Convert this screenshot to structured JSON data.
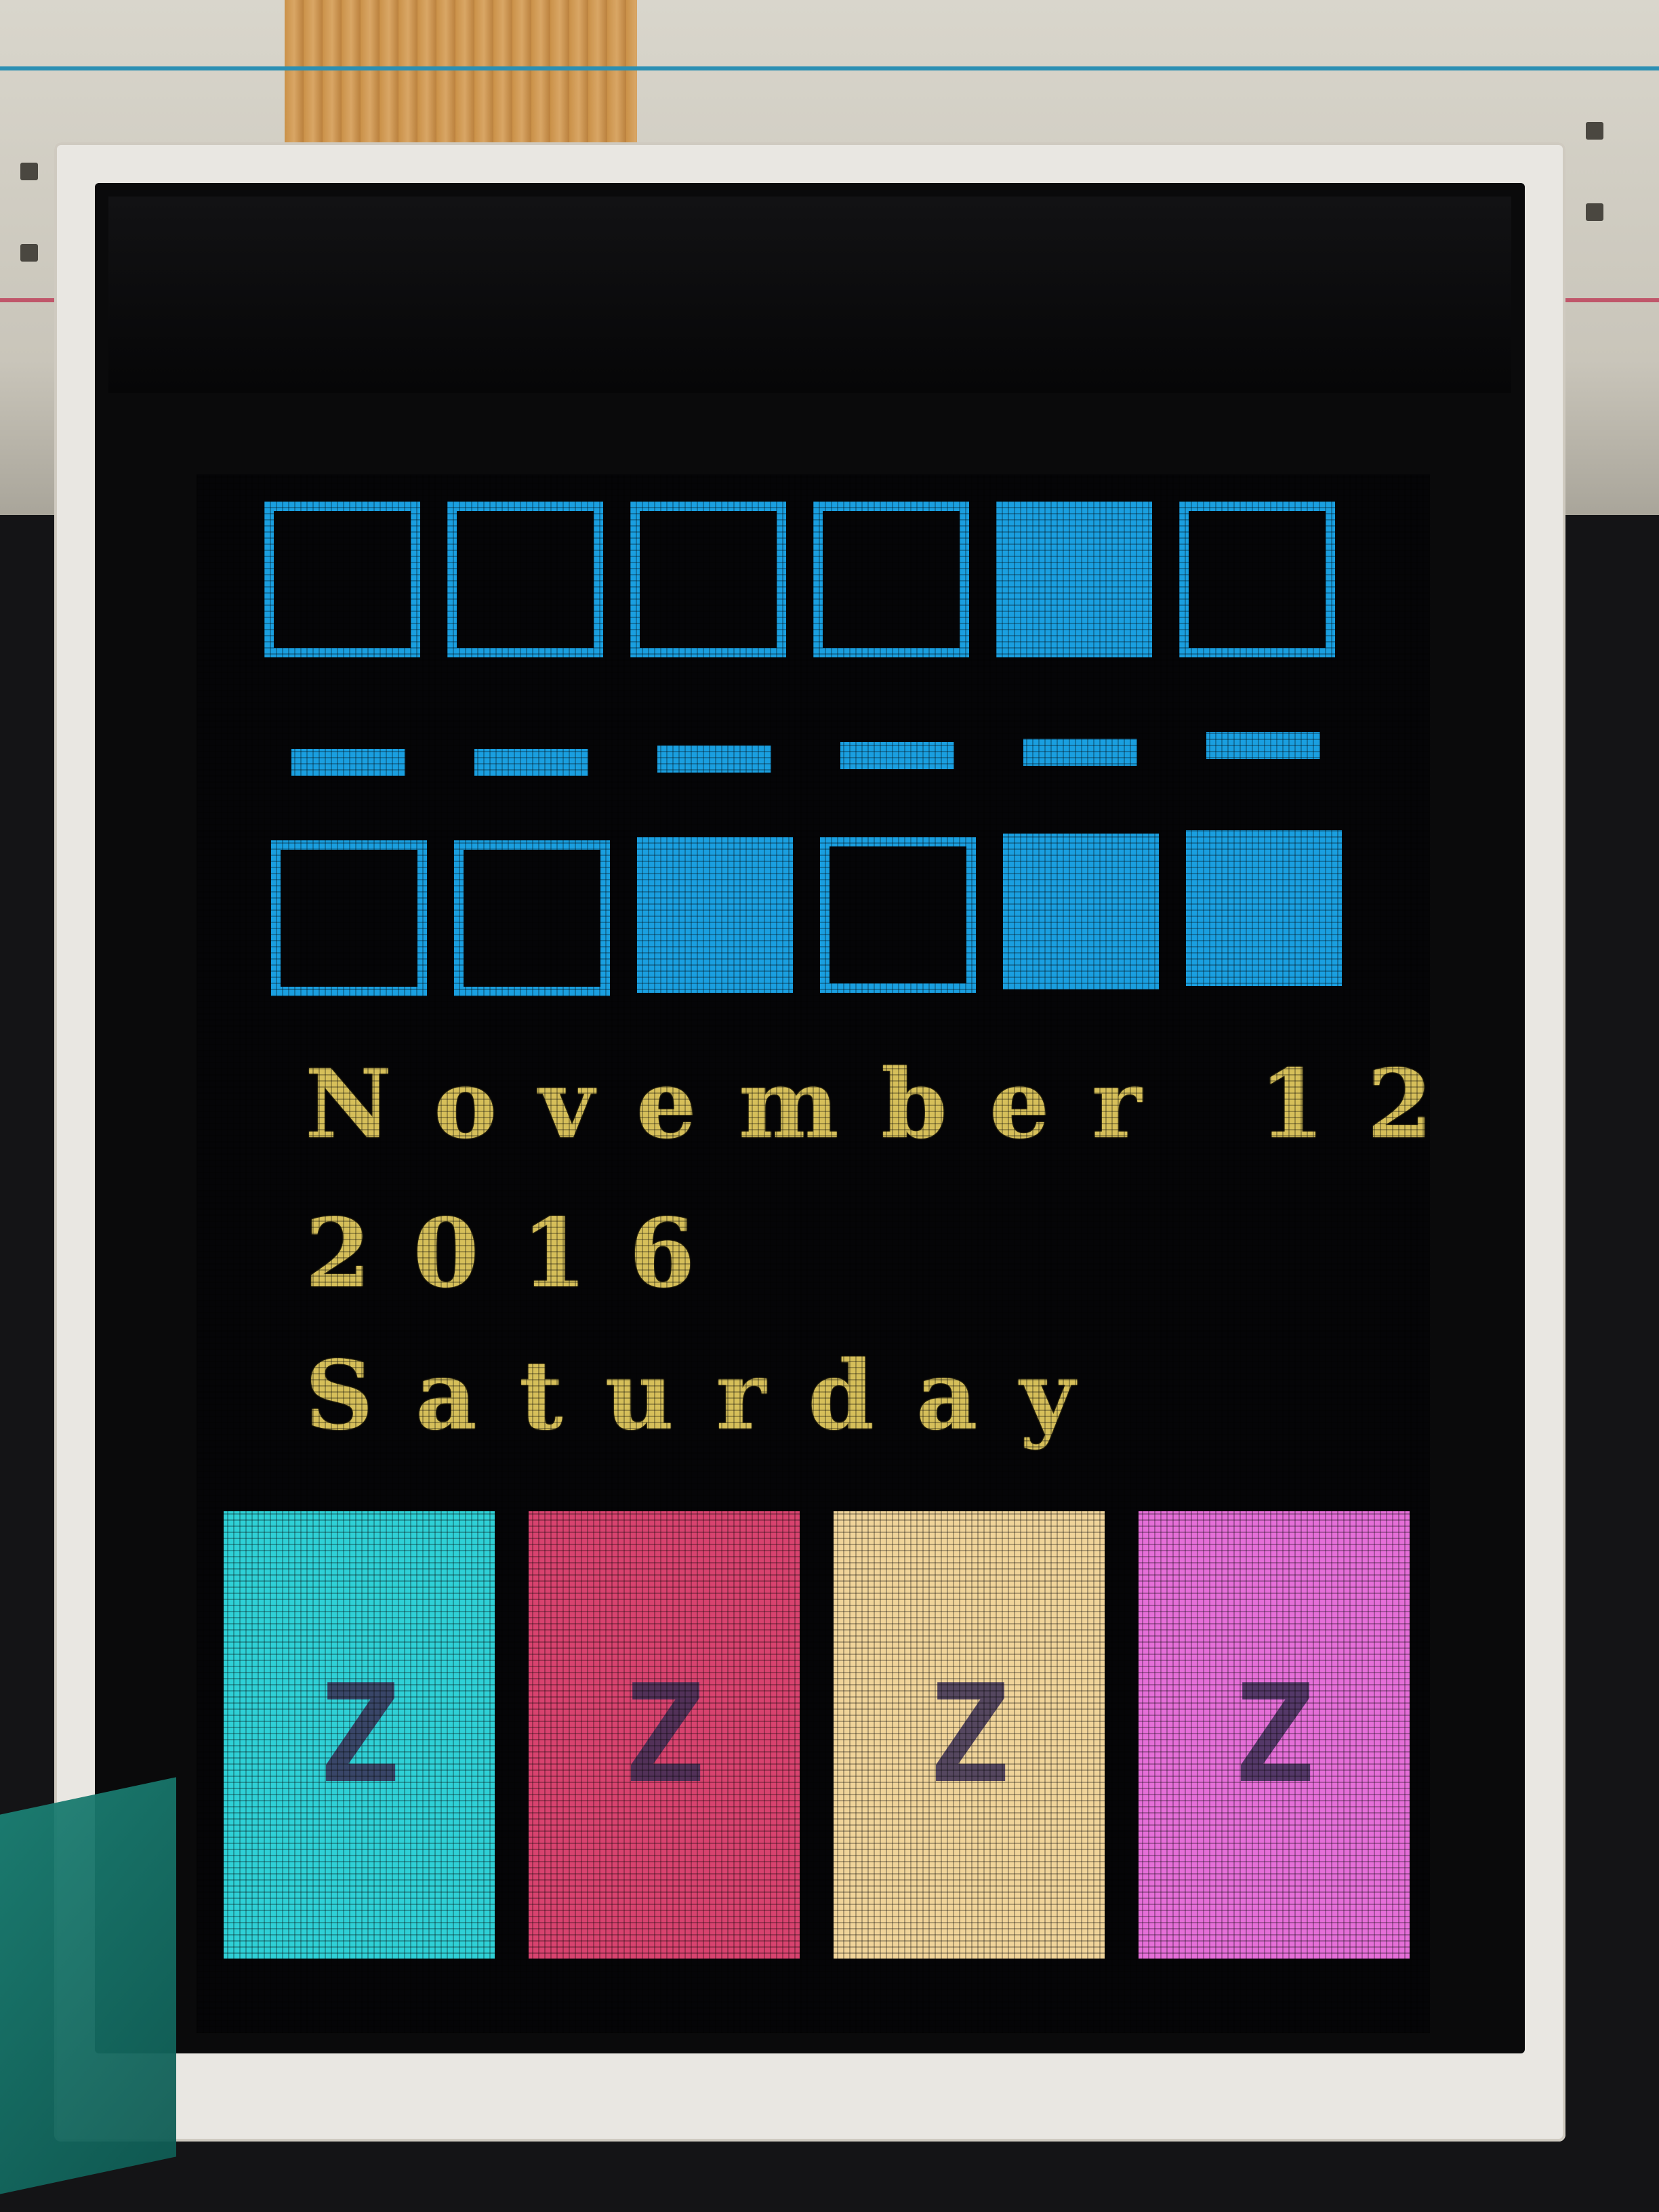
{
  "display": {
    "top_row_bits": [
      false,
      false,
      false,
      false,
      true,
      false
    ],
    "bottom_row_bits": [
      false,
      false,
      true,
      false,
      true,
      true
    ],
    "date_line": "November 12",
    "year_line": "2016",
    "weekday_line": "Saturday",
    "bars": [
      {
        "label": "Z",
        "color": "#2fd0d6"
      },
      {
        "label": "Z",
        "color": "#d8436f"
      },
      {
        "label": "Z",
        "color": "#f0d49a"
      },
      {
        "label": "Z",
        "color": "#e56fd8"
      }
    ],
    "accent_color": "#1a9fe0",
    "text_color": "#d6bf5a"
  }
}
